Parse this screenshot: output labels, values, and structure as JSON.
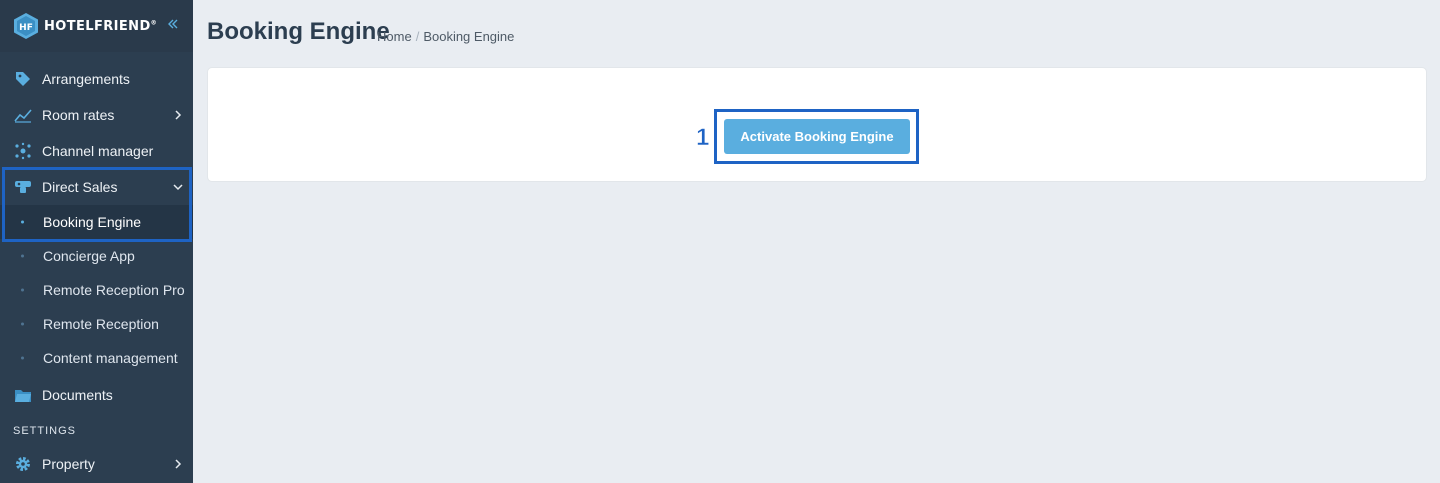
{
  "brand": {
    "name": "HOTELFRIEND",
    "trademark": "®",
    "logo_letters": "HF"
  },
  "sidebar": {
    "items": [
      {
        "label": "Arrangements",
        "icon": "tag-icon"
      },
      {
        "label": "Room rates",
        "icon": "chart-icon",
        "has_submenu": true
      },
      {
        "label": "Channel manager",
        "icon": "network-icon"
      },
      {
        "label": "Direct Sales",
        "icon": "direct-sales-icon",
        "expanded": true
      },
      {
        "label": "Documents",
        "icon": "folder-icon"
      }
    ],
    "direct_sales_subitems": [
      {
        "label": "Booking Engine",
        "active": true
      },
      {
        "label": "Concierge App"
      },
      {
        "label": "Remote Reception Pro"
      },
      {
        "label": "Remote Reception"
      },
      {
        "label": "Content management"
      }
    ],
    "settings_label": "SETTINGS",
    "settings_items": [
      {
        "label": "Property",
        "icon": "gear-icon",
        "has_submenu": true
      }
    ]
  },
  "header": {
    "title": "Booking Engine",
    "breadcrumb": [
      "Home",
      "Booking Engine"
    ]
  },
  "main": {
    "activate_button": "Activate Booking Engine",
    "step_marker": "1"
  },
  "colors": {
    "sidebar_bg": "#2c3e50",
    "accent": "#5aaedf",
    "highlight": "#1e63c4",
    "page_bg": "#e9edf2"
  }
}
